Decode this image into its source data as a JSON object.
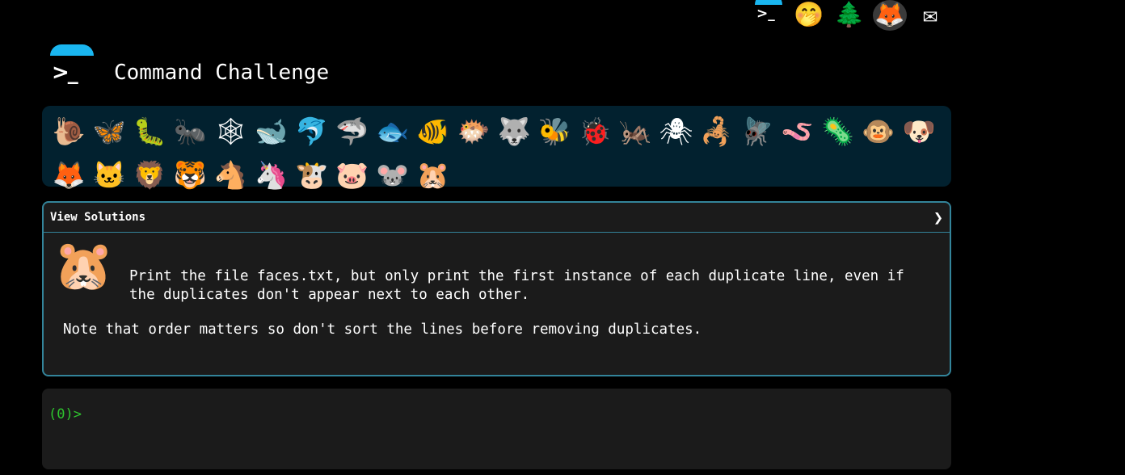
{
  "header": {
    "title": "Command Challenge",
    "logo_prompt": ">_",
    "nav": [
      {
        "name": "command-challenge-logo-icon",
        "glyph": ">_"
      },
      {
        "name": "shushing-face-icon",
        "glyph": "🤭"
      },
      {
        "name": "evergreen-tree-icon",
        "glyph": "🌲"
      },
      {
        "name": "gitlab-icon",
        "glyph": "🦊"
      },
      {
        "name": "envelope-icon",
        "glyph": "✉"
      }
    ]
  },
  "animals": [
    {
      "name": "snail",
      "glyph": "🐌"
    },
    {
      "name": "butterfly",
      "glyph": "🦋"
    },
    {
      "name": "caterpillar",
      "glyph": "🐛"
    },
    {
      "name": "ant",
      "glyph": "🐜"
    },
    {
      "name": "spider-web",
      "glyph": "🕸"
    },
    {
      "name": "whale",
      "glyph": "🐋"
    },
    {
      "name": "dolphin",
      "glyph": "🐬"
    },
    {
      "name": "shark",
      "glyph": "🦈"
    },
    {
      "name": "fish",
      "glyph": "🐟"
    },
    {
      "name": "tropical-fish",
      "glyph": "🐠"
    },
    {
      "name": "blowfish",
      "glyph": "🐡"
    },
    {
      "name": "wolf",
      "glyph": "🐺"
    },
    {
      "name": "bee",
      "glyph": "🐝"
    },
    {
      "name": "ladybug",
      "glyph": "🐞"
    },
    {
      "name": "cricket",
      "glyph": "🦗"
    },
    {
      "name": "spider",
      "glyph": "🕷"
    },
    {
      "name": "scorpion",
      "glyph": "🦂"
    },
    {
      "name": "fly",
      "glyph": "🪰"
    },
    {
      "name": "worm",
      "glyph": "🪱"
    },
    {
      "name": "microbe",
      "glyph": "🦠"
    },
    {
      "name": "monkey",
      "glyph": "🐵"
    },
    {
      "name": "dog",
      "glyph": "🐶"
    },
    {
      "name": "fox",
      "glyph": "🦊"
    },
    {
      "name": "cat",
      "glyph": "🐱"
    },
    {
      "name": "lion",
      "glyph": "🦁"
    },
    {
      "name": "tiger",
      "glyph": "🐯"
    },
    {
      "name": "horse",
      "glyph": "🐴"
    },
    {
      "name": "unicorn",
      "glyph": "🦄"
    },
    {
      "name": "cow",
      "glyph": "🐮"
    },
    {
      "name": "pig",
      "glyph": "🐷"
    },
    {
      "name": "mouse",
      "glyph": "🐭"
    },
    {
      "name": "hamster",
      "glyph": "🐹"
    }
  ],
  "panel": {
    "toggle_label": "View Solutions",
    "chevron": "❯",
    "avatar_glyph": "🐹",
    "task": "Print the file faces.txt, but only print the first instance of each duplicate line, even if\nthe duplicates don't appear next to each other.",
    "note": "Note that order matters so don't sort the lines before removing duplicates."
  },
  "terminal": {
    "prompt": "(0)>"
  }
}
